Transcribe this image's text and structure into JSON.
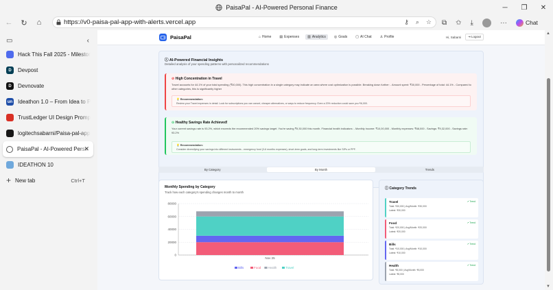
{
  "window": {
    "title": "PaisaPal - AI-Powered Personal Finance"
  },
  "browser": {
    "url": "https://v0-paisa-pal-app-with-alerts.vercel.app",
    "chat_label": "Chat"
  },
  "tabs": [
    {
      "title": "Hack This Fall 2025 - Milestone",
      "color": "#4f6bed",
      "glyph": ""
    },
    {
      "title": "Devpost",
      "color": "#003e54",
      "glyph": "D"
    },
    {
      "title": "Devnovate",
      "color": "#111111",
      "glyph": "D"
    },
    {
      "title": "Ideathon 1.0 – From Idea to Pro",
      "color": "#1f4ea8",
      "glyph": "un"
    },
    {
      "title": "TrustLedger UI Design Prompt",
      "color": "#d93025",
      "glyph": ""
    },
    {
      "title": "logitechsabarni/Paisa-pal-app",
      "color": "#181717",
      "glyph": ""
    },
    {
      "title": "PaisaPal - AI-Powered Perso",
      "color": "#555555",
      "glyph": ""
    },
    {
      "title": "IDEATHON 10",
      "color": "#6fa8dc",
      "glyph": ""
    }
  ],
  "new_tab": {
    "label": "New tab",
    "shortcut": "Ctrl+T"
  },
  "app": {
    "brand": "PaisaPal",
    "nav": [
      "Home",
      "Expenses",
      "Analytics",
      "Goals",
      "AI Chat",
      "Profile"
    ],
    "greeting": "Hi, Sabarni",
    "logout": "Logout"
  },
  "insights": {
    "title": "AI-Powered Financial Insights",
    "subtitle": "Detailed analysis of your spending patterns with personalized recommendations",
    "alerts": [
      {
        "heading": "High Concentration in Travel",
        "desc": "Travel accounts for 44.1% of your total spending (₹30,000). This high concentration in a single category may indicate an area where cost optimization is possible. Breaking down further: - Amount spent: ₹30,000 - Percentage of total: 44.1% - Compared to other categories, this is significantly higher",
        "rec_title": "💡 Recommendation:",
        "rec": "Review your Travel expenses in detail. Look for subscriptions you can cancel, cheaper alternatives, or ways to reduce frequency. Even a 20% reduction could save you ₹6,000."
      },
      {
        "heading": "Healthy Savings Rate Achieved!",
        "desc": "Your current savings rate is 93.2%, which exceeds the recommended 20% savings target. You're saving ₹9,30,000 this month. Financial health indicators: - Monthly income: ₹10,00,000 - Monthly expenses: ₹68,000 - Savings: ₹9,32,000 - Savings rate: 93.2%",
        "rec_title": "💡 Recommendation:",
        "rec": "Consider diversifying your savings into different instruments - emergency fund (3-6 months expenses), short-term goals, and long-term investments like SIPs or PPF."
      }
    ]
  },
  "view_tabs": [
    "By Category",
    "By Month",
    "Trends"
  ],
  "chart_card": {
    "title": "Monthly Spending by Category",
    "subtitle": "Track how each category's spending changes month to month"
  },
  "chart_data": {
    "type": "bar",
    "stacked": true,
    "categories": [
      "Nov 25"
    ],
    "series": [
      {
        "name": "Bills",
        "values": [
          10000
        ],
        "color": "#6366f1"
      },
      {
        "name": "Food",
        "values": [
          20000
        ],
        "color": "#f25c78"
      },
      {
        "name": "Health",
        "values": [
          8000
        ],
        "color": "#9ca3af"
      },
      {
        "name": "Travel",
        "values": [
          30000
        ],
        "color": "#4fd1c5"
      }
    ],
    "stack_order": [
      "Food",
      "Bills",
      "Travel",
      "Health"
    ],
    "yticks": [
      "80000",
      "60000",
      "40000",
      "20000",
      "0"
    ],
    "ylim": [
      0,
      80000
    ],
    "legend": "bottom",
    "grid": true
  },
  "trends": {
    "title": "Category Trends",
    "items": [
      {
        "name": "Travel",
        "line1": "Total: ₹30,000 | Avg/Month: ₹30,000",
        "line2": "Latest: ₹30,000",
        "tag": "↗ Trend",
        "color": "#4fd1c5"
      },
      {
        "name": "Food",
        "line1": "Total: ₹20,000 | Avg/Month: ₹20,000",
        "line2": "Latest: ₹20,000",
        "tag": "↗ Trend",
        "color": "#f25c78"
      },
      {
        "name": "Bills",
        "line1": "Total: ₹10,000 | Avg/Month: ₹10,000",
        "line2": "Latest: ₹10,000",
        "tag": "↗ Trend",
        "color": "#6366f1"
      },
      {
        "name": "Health",
        "line1": "Total: ₹8,000 | Avg/Month: ₹8,000",
        "line2": "Latest: ₹8,000",
        "tag": "↗ Trend",
        "color": "#9ca3af"
      }
    ]
  }
}
